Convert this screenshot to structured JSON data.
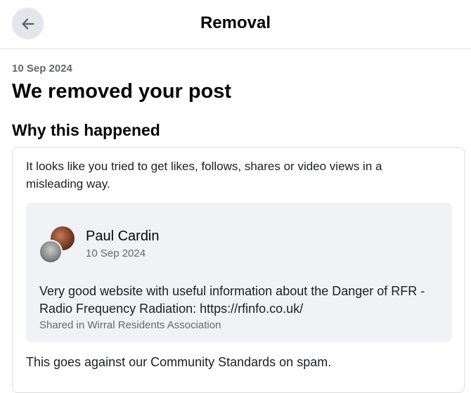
{
  "header": {
    "title": "Removal",
    "back_icon": "arrow-left-icon"
  },
  "notice": {
    "date": "10 Sep 2024",
    "title": "We removed your post",
    "section_title": "Why this happened",
    "reason": "It looks like you tried to get likes, follows, shares or video views in a misleading way.",
    "policy": "This goes against our Community Standards on spam."
  },
  "post": {
    "author": "Paul Cardin",
    "date": "10 Sep 2024",
    "text": "Very good website with useful information about the Danger of RFR - Radio Frequency Radiation: https://rfinfo.co.uk/",
    "shared_in": "Shared in Wirral Residents Association"
  },
  "colors": {
    "secondary_text": "#65676b",
    "button_bg": "#e4e6eb",
    "post_bg": "#f0f2f5"
  }
}
